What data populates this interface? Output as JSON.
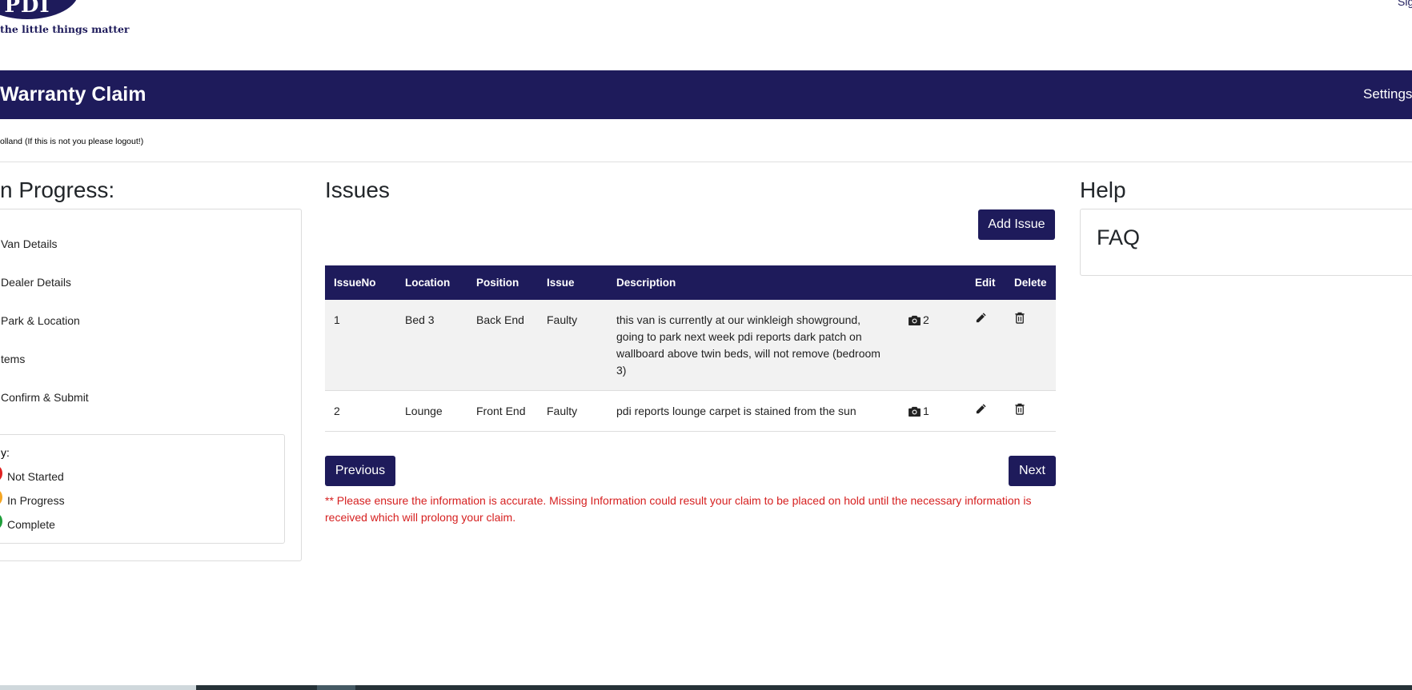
{
  "brand": {
    "logo_text": "PDI",
    "tagline": "the little things matter",
    "signout_partial": "Sig"
  },
  "header": {
    "title": "Warranty Claim",
    "settings_label": "Settings"
  },
  "user_notice": "olland (If this is not you please logout!)",
  "progress": {
    "heading": "n Progress:",
    "steps": [
      {
        "label": "Van Details"
      },
      {
        "label": "Dealer Details"
      },
      {
        "label": "Park & Location"
      },
      {
        "label": "tems"
      },
      {
        "label": "Confirm & Submit"
      }
    ],
    "key": {
      "title": "y:",
      "items": [
        {
          "label": "Not Started",
          "color": "#e02020"
        },
        {
          "label": "In Progress",
          "color": "#f5a623"
        },
        {
          "label": "Complete",
          "color": "#1e9e3a"
        }
      ]
    }
  },
  "issues": {
    "heading": "Issues",
    "add_button": "Add Issue",
    "columns": [
      "IssueNo",
      "Location",
      "Position",
      "Issue",
      "Description",
      "",
      "Edit",
      "Delete"
    ],
    "rows": [
      {
        "no": "1",
        "location": "Bed 3",
        "position": "Back End",
        "issue": "Faulty",
        "description": "this van is currently at our winkleigh showground, going to park next week pdi reports dark patch on wallboard above twin beds, will not remove (bedroom 3)",
        "photos": "2"
      },
      {
        "no": "2",
        "location": "Lounge",
        "position": "Front End",
        "issue": "Faulty",
        "description": "pdi reports lounge carpet is stained from the sun",
        "photos": "1"
      }
    ],
    "previous_button": "Previous",
    "next_button": "Next",
    "warning": "** Please ensure the information is accurate. Missing Information could result your claim to be placed on hold until the necessary information is received which will prolong your claim."
  },
  "help": {
    "heading": "Help",
    "faq_label": "FAQ"
  },
  "colors": {
    "brand_navy": "#1e1b5b",
    "warning_red": "#d62020"
  }
}
